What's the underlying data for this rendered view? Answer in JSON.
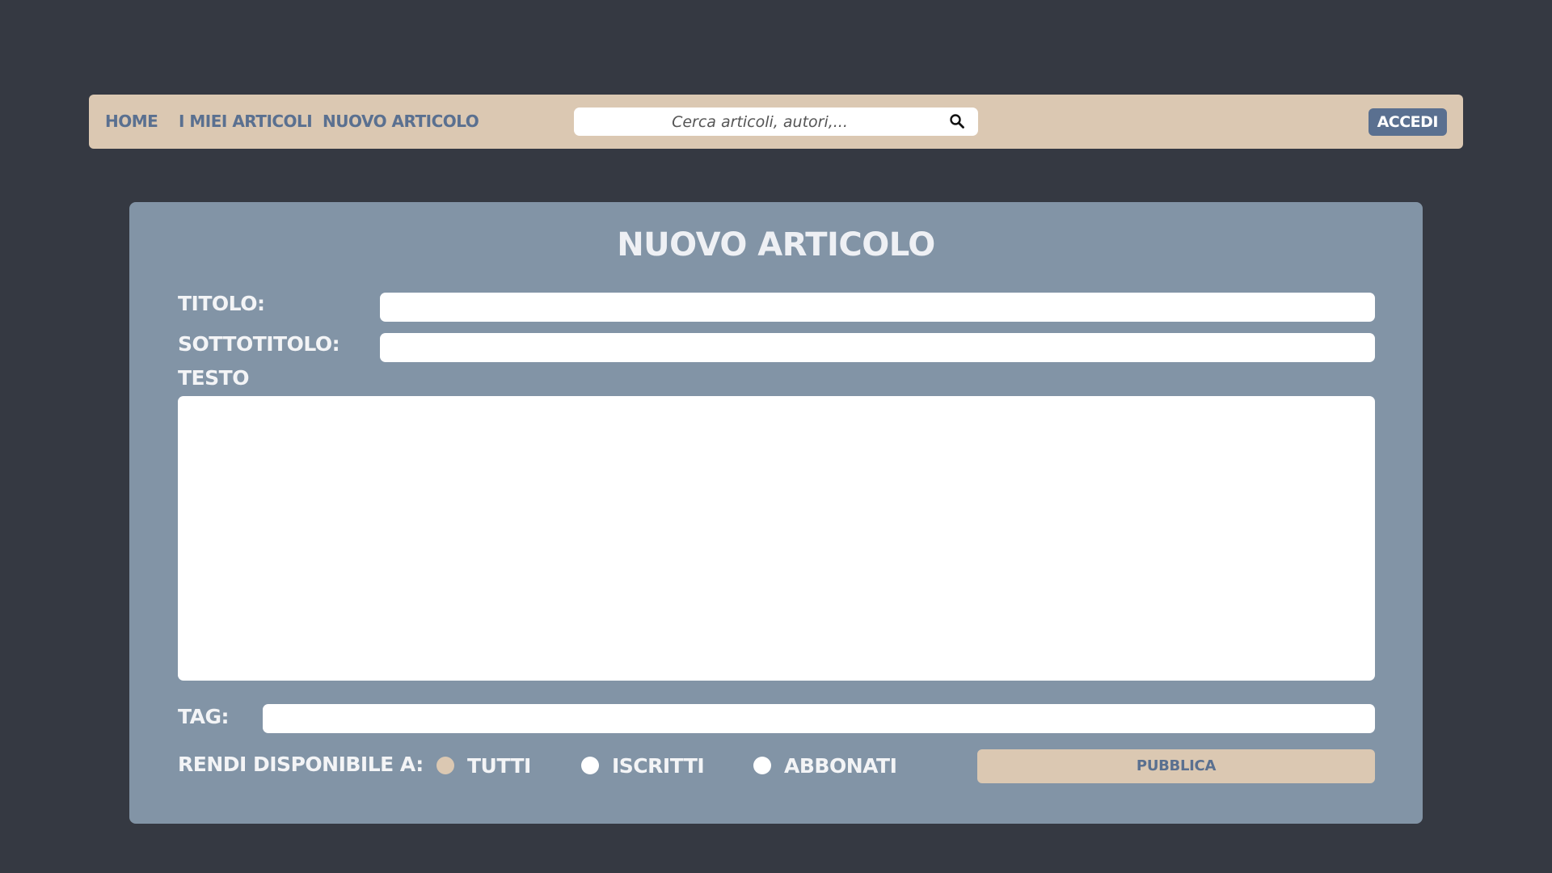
{
  "nav": {
    "links": [
      "HOME",
      "I MIEI ARTICOLI",
      "NUOVO ARTICOLO"
    ],
    "search_placeholder": "Cerca articoli, autori,...",
    "search_icon": "search-icon",
    "login_label": "ACCEDI"
  },
  "form": {
    "title": "NUOVO ARTICOLO",
    "labels": {
      "titolo": "TITOLO:",
      "sottotitolo": "SOTTOTITOLO:",
      "testo": "TESTO",
      "tag": "TAG:",
      "availability": "RENDI DISPONIBILE A:"
    },
    "values": {
      "titolo": "",
      "sottotitolo": "",
      "testo": "",
      "tag": ""
    },
    "availability_options": [
      "TUTTI",
      "ISCRITTI",
      "ABBONATI"
    ],
    "availability_selected": "TUTTI",
    "publish_label": "PUBBLICA"
  },
  "colors": {
    "background": "#353942",
    "navbar": "#dbc8b2",
    "accent": "#5a7090",
    "card": "#8294a6"
  }
}
